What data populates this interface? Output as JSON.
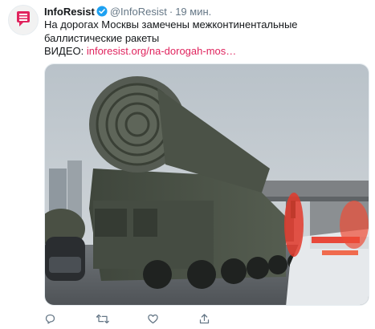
{
  "tweet": {
    "author_name": "InfoResist",
    "handle": "@InfoResist",
    "separator": "·",
    "time": "19 мин.",
    "text": "На дорогах Москвы замечены межконтинентальные баллистические ракеты",
    "video_label": "ВИДЕО:",
    "link_text": "inforesist.org/na-dorogah-mos…"
  },
  "icons": {
    "avatar": "inforesist-logo-icon",
    "verified": "verified-badge-icon",
    "reply": "reply-icon",
    "retweet": "retweet-icon",
    "like": "heart-icon",
    "share": "share-icon"
  },
  "colors": {
    "link": "#e0245e",
    "verified": "#1da1f2",
    "logo": "#e0245e",
    "muted": "#657786"
  }
}
